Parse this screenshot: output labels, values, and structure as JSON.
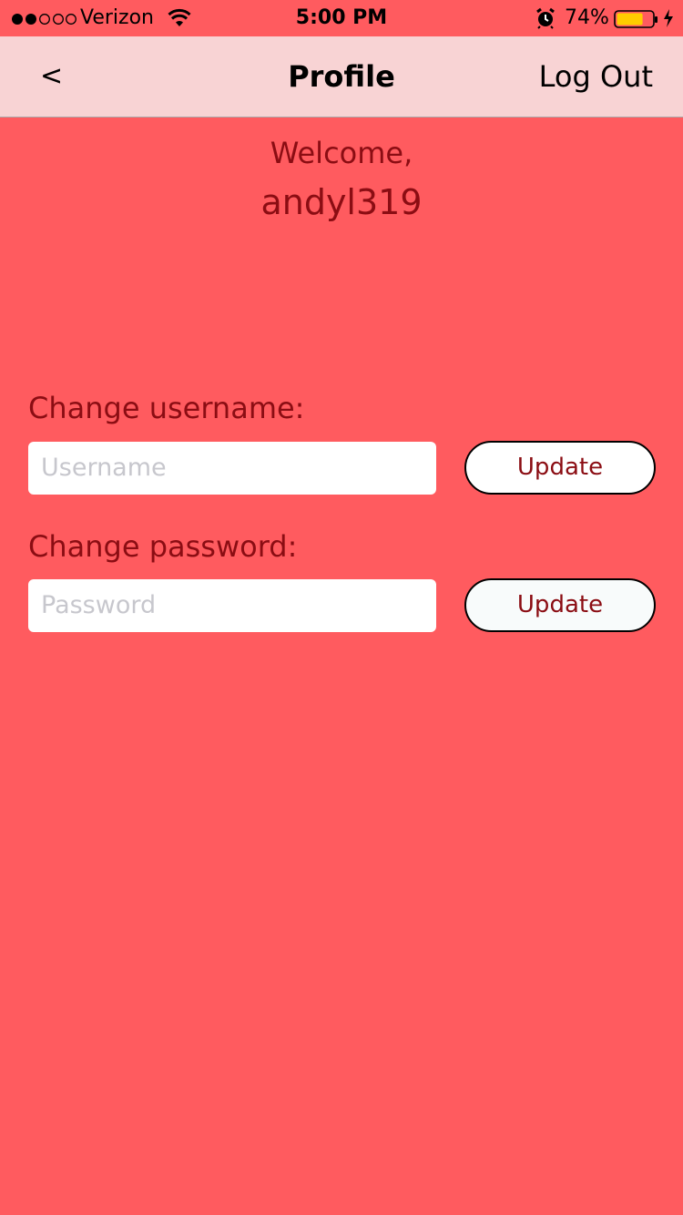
{
  "status_bar": {
    "carrier": "Verizon",
    "time": "5:00 PM",
    "battery_percent": "74%",
    "battery_level": 0.74,
    "signal_bars_filled": 2,
    "signal_bars_total": 5,
    "battery_color": "#ffcc00",
    "icons": [
      "signal-icon",
      "wifi-icon",
      "alarm-icon",
      "battery-icon",
      "charging-bolt-icon"
    ]
  },
  "nav": {
    "back_label": "<",
    "title": "Profile",
    "logout_label": "Log Out",
    "background_color": "#f8d3d4"
  },
  "welcome": {
    "greeting": "Welcome,",
    "username": "andyl319"
  },
  "form": {
    "username_section": {
      "label": "Change username:",
      "placeholder": "Username",
      "value": "",
      "button_label": "Update"
    },
    "password_section": {
      "label": "Change password:",
      "placeholder": "Password",
      "value": "",
      "button_label": "Update"
    }
  },
  "colors": {
    "background": "#ff5b5f",
    "accent_text": "#8b0d13"
  }
}
